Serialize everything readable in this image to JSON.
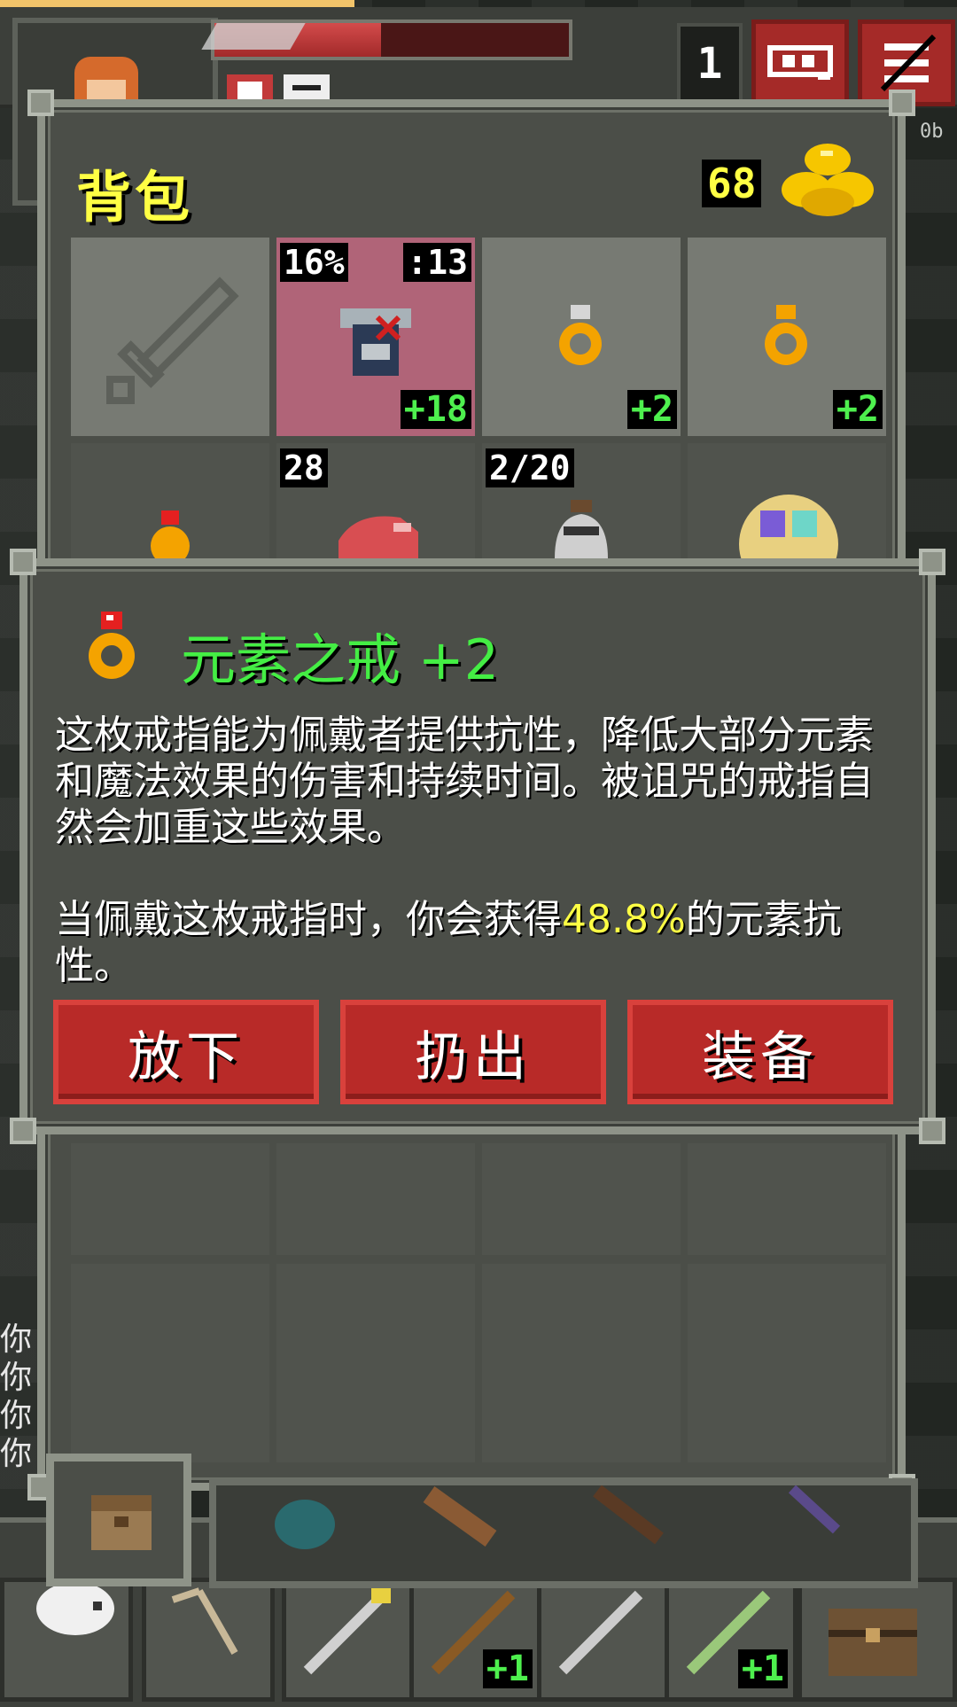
{
  "hud": {
    "depth": "1",
    "hp_fraction": 0.47,
    "version_text": "0b",
    "log_lines": [
      "你",
      "你",
      "你",
      "你"
    ],
    "icons": [
      "hero-portrait-icon",
      "search-icon",
      "menu-icon"
    ]
  },
  "inventory": {
    "title": "背包",
    "gold": "68",
    "equipped_slots": [
      {
        "icon": "sword-outline-icon",
        "tag_left": "",
        "tag_right": "",
        "bonus": "",
        "highlight": false
      },
      {
        "icon": "armor-icon",
        "tag_left": "16%",
        "tag_right": ":13",
        "bonus": "+18",
        "highlight": true
      },
      {
        "icon": "ring-icon",
        "tag_left": "",
        "tag_right": "",
        "bonus": "+2",
        "highlight": false
      },
      {
        "icon": "ring-icon",
        "tag_left": "",
        "tag_right": "",
        "bonus": "+2",
        "highlight": false
      }
    ],
    "second_row": [
      {
        "icon": "ring-red-gem-icon",
        "tag": ""
      },
      {
        "icon": "meat-icon",
        "tag": "28"
      },
      {
        "icon": "waterskin-icon",
        "tag": "2/20"
      },
      {
        "icon": "orb-icon",
        "tag": ""
      }
    ]
  },
  "item_info": {
    "icon": "ring-red-gem-icon",
    "title": "元素之戒 +2",
    "desc_1": "这枚戒指能为佩戴者提供抗性，降低大部分元素和魔法效果的伤害和持续时间。被诅咒的戒指自然会加重这些效果。",
    "desc_2_pre": "当佩戴这枚戒指时，你会获得",
    "desc_2_value": "48.8%",
    "desc_2_post": "的元素抗性。",
    "buttons": {
      "drop": "放下",
      "throw": "扔出",
      "equip": "装备"
    }
  },
  "quickbar": {
    "bonus_1": "+1",
    "bonus_2": "+1",
    "icons": [
      "skull-icon",
      "slingshot-icon",
      "wand-yellow-icon",
      "wand-brown-icon",
      "wand-silver-icon",
      "wand-green-icon",
      "chest-icon"
    ],
    "bag_tabs": [
      "backpack-icon",
      "pouch-icon",
      "scroll-holder-icon",
      "wand-holster-icon",
      "potion-bandolier-icon"
    ]
  },
  "colors": {
    "title_yellow": "#ffff44",
    "item_green": "#44ee44",
    "button_red": "#b82a28",
    "panel": "#4b4e48"
  }
}
